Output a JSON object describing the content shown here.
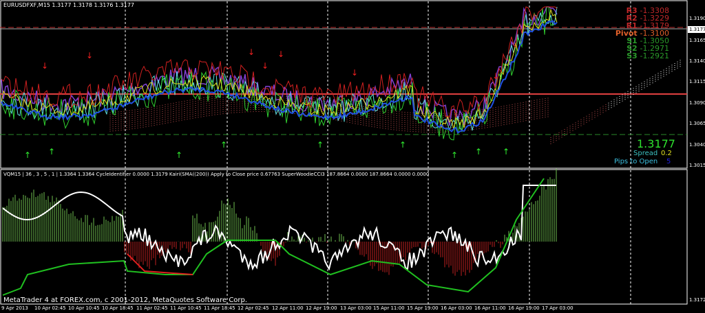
{
  "header": {
    "symbol_line": "EURUSDFXF,M15  1.3177 1.3178 1.3176 1.3177"
  },
  "indicator_header": "VQM15 | 36 , 3 , 5 , 1 | 1.3364 1.3364  CycleIdentifier 0.0000 1.3179  Kairi(SMA((200)) Apply to Close price 0.67763  SuperWoodieCCI3 187.8664 0.0000 187.8664 0.0000 0.0000",
  "footer": "MetaTrader 4 at FOREX.com, c 2001-2012, MetaQuotes Software Corp.",
  "pivots": [
    {
      "label": "R3",
      "value": "-1.3308",
      "color": "#c0282a"
    },
    {
      "label": "R2",
      "value": "-1.3229",
      "color": "#c0282a"
    },
    {
      "label": "R1",
      "value": "-1.3179",
      "color": "#c0282a"
    },
    {
      "label": "Pivot",
      "value": "-1.3100",
      "color": "#e0602a"
    },
    {
      "label": "S1",
      "value": "-1.3050",
      "color": "#2a9a2a"
    },
    {
      "label": "S2",
      "value": "-1.2971",
      "color": "#2a9a2a"
    },
    {
      "label": "S3",
      "value": "-1.2921",
      "color": "#2a9a2a"
    }
  ],
  "info": {
    "price": "1.3177",
    "spread_label": "Spread",
    "spread_value": "0.2",
    "pips_label": "Pips to Open",
    "pips_value": "5"
  },
  "price_axis": [
    "1.3190",
    "1.3165",
    "1.3140",
    "1.3115",
    "1.3090",
    "1.3065",
    "1.3040",
    "1.3015"
  ],
  "current_price": "1.3177",
  "indicator_axis_label": "1.3172",
  "time_axis": [
    "9 Apr 2013",
    "10 Apr 02:45",
    "10 Apr 10:45",
    "10 Apr 18:45",
    "11 Apr 02:45",
    "11 Apr 10:45",
    "11 Apr 18:45",
    "12 Apr 02:45",
    "12 Apr 11:00",
    "12 Apr 19:00",
    "13 Apr 03:00",
    "15 Apr 11:00",
    "15 Apr 19:00",
    "16 Apr 03:00",
    "16 Apr 11:00",
    "16 Apr 19:00",
    "17 Apr 03:00"
  ]
}
